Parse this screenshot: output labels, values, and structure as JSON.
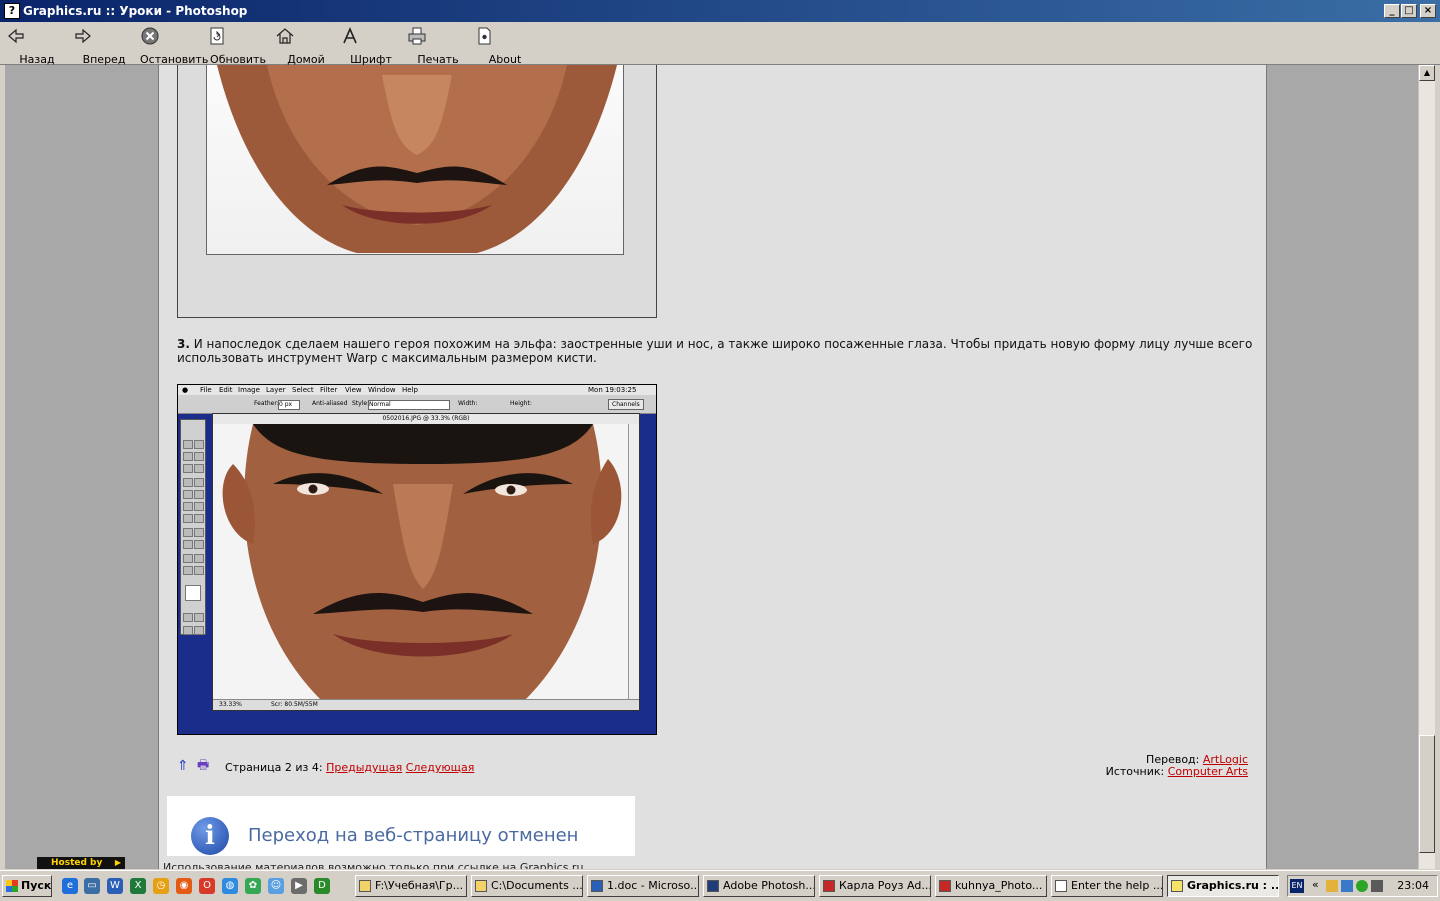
{
  "window": {
    "title": "Graphics.ru :: Уроки - Photoshop"
  },
  "toolbar": {
    "back": "Назад",
    "forward": "Вперед",
    "stop": "Остановить",
    "refresh": "Обновить",
    "home": "Домой",
    "font": "Шрифт",
    "print": "Печать",
    "about": "About"
  },
  "article": {
    "step_number": "3.",
    "step_text": "И напоследок сделаем нашего героя похожим на эльфа: заостренные уши и нос, а также широко посаженные глаза. Чтобы придать новую форму лицу лучше всего использовать инструмент Warp с максимальным размером кисти."
  },
  "screenshot": {
    "menu": [
      "File",
      "Edit",
      "Image",
      "Layer",
      "Select",
      "Filter",
      "View",
      "Window",
      "Help"
    ],
    "clock": "Mon 19:03:25",
    "feather_label": "Feather:",
    "feather_value": "0 px",
    "antialiased": "Anti-aliased",
    "style_label": "Style:",
    "style_value": "Normal",
    "width_label": "Width:",
    "height_label": "Height:",
    "palette_tab": "Channels",
    "doc_title": "0502016.JPG @ 33.3% (RGB)",
    "zoom": "33.33%",
    "scr": "Scr: 80.5M/55M"
  },
  "pager": {
    "page_text": "Страница 2 из 4:",
    "prev": "Предыдущая",
    "next": "Следующая"
  },
  "credits": {
    "translation_label": "Перевод:",
    "translation_link": "ArtLogic",
    "source_label": "Источник:",
    "source_link": "Computer Arts"
  },
  "nav_cancel": {
    "message": "Переход на веб-страницу отменен"
  },
  "footer": {
    "hosted": "Hosted by",
    "note": "Использование материалов возможно только при ссылке на Graphics.ru"
  },
  "taskbar": {
    "start": "Пуск",
    "tasks": [
      "F:\\Учебная\\Гр...",
      "C:\\Documents ...",
      "1.doc - Microso...",
      "Adobe Photosh...",
      "Карла Роуз Ad...",
      "kuhnya_Photo...",
      "Enter the help ...",
      "Graphics.ru : ..."
    ],
    "lang": "EN",
    "clock": "23:04"
  }
}
